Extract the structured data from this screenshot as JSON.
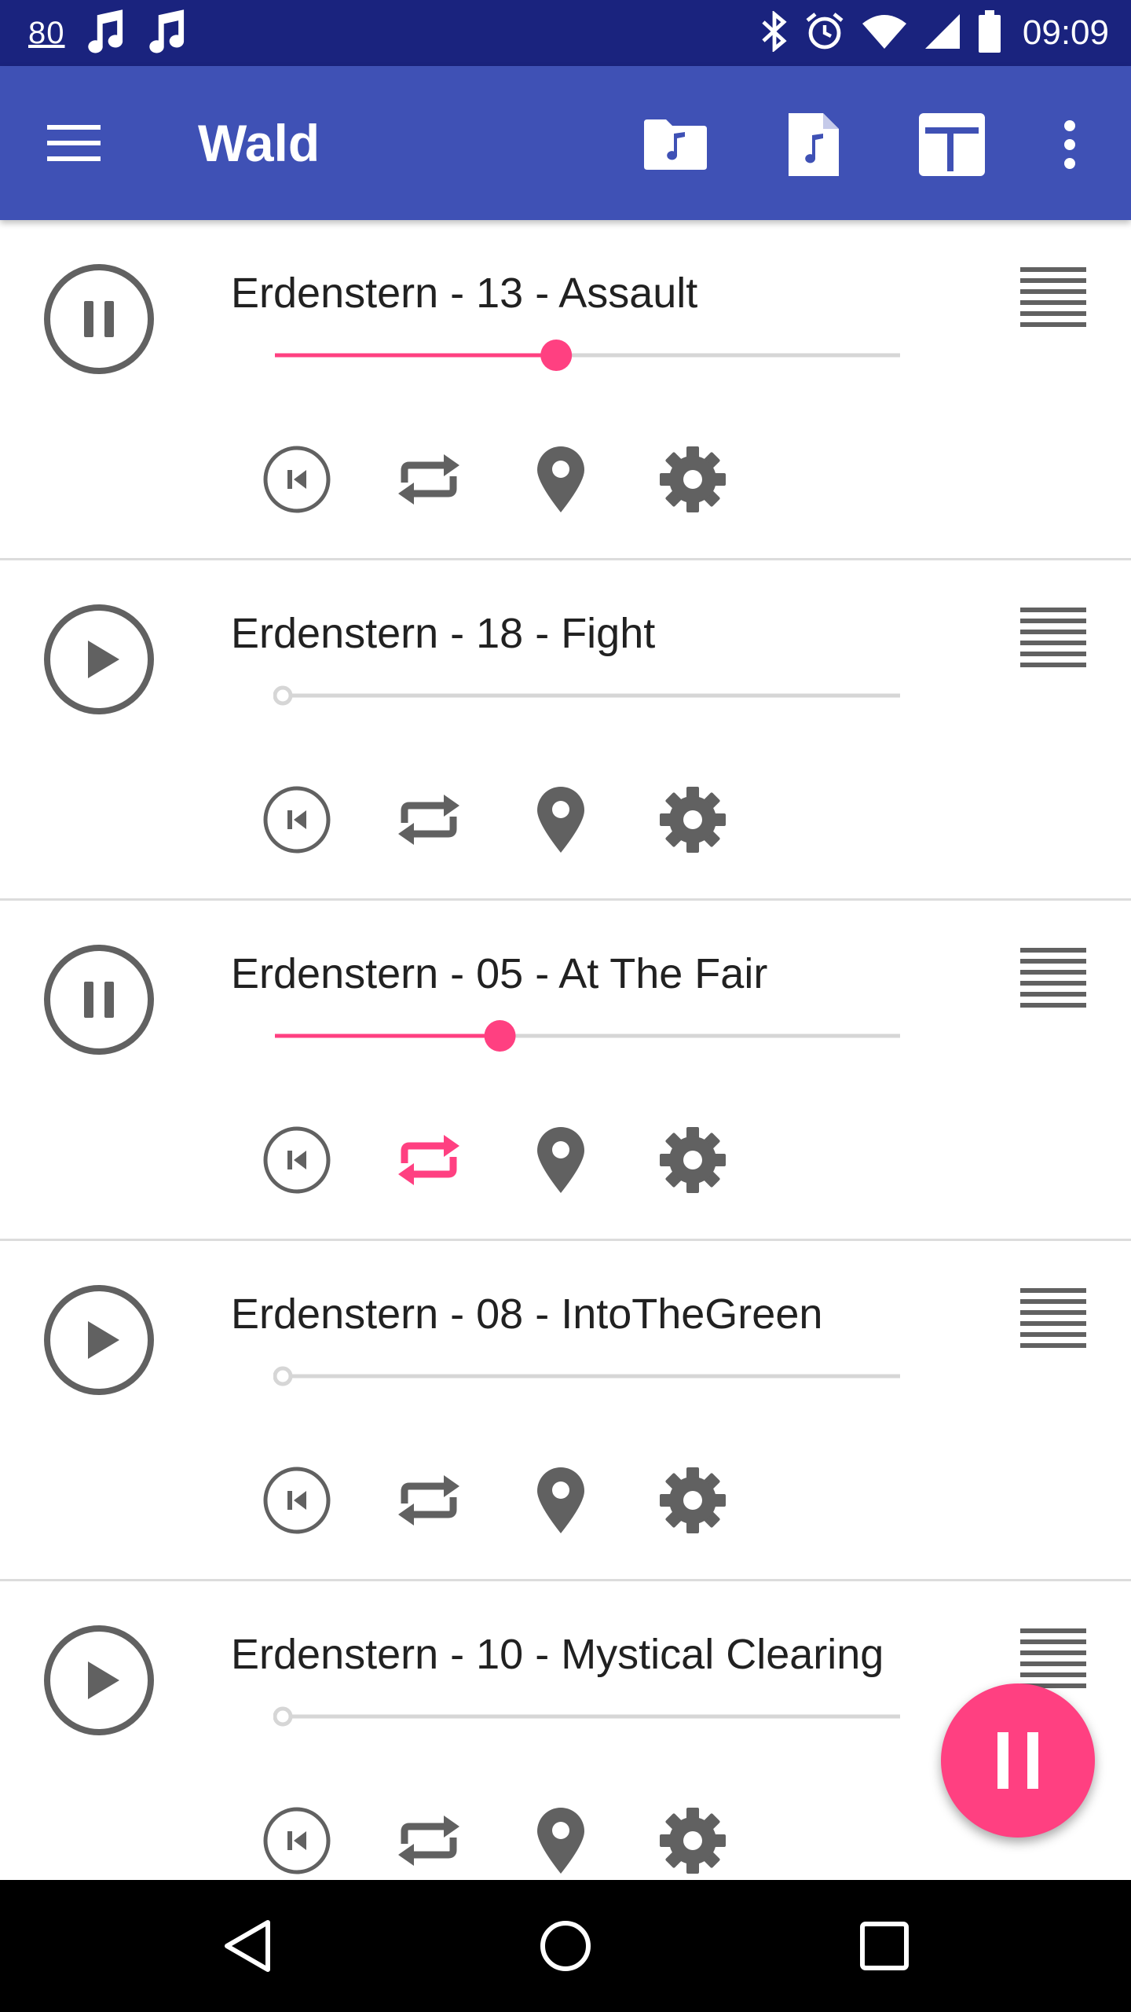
{
  "status_bar": {
    "left_number": "80",
    "time": "09:09",
    "icons": [
      "music-note-icon",
      "music-note-icon",
      "bluetooth-icon",
      "alarm-icon",
      "wifi-icon",
      "signal-icon",
      "battery-icon"
    ]
  },
  "toolbar": {
    "title": "Wald",
    "actions": [
      "add-folder-music-icon",
      "add-file-music-icon",
      "grid-layout-icon",
      "more-vert-icon"
    ]
  },
  "colors": {
    "status_bar": "#1a237e",
    "toolbar": "#3f51b5",
    "accent": "#ff4081",
    "icon_gray": "#616161",
    "track_gray": "#d6d6d6"
  },
  "tracks": [
    {
      "title": "Erdenstern - 13 - Assault",
      "playing": true,
      "progress": 0.45,
      "repeat_active": false
    },
    {
      "title": "Erdenstern - 18 - Fight",
      "playing": false,
      "progress": 0,
      "repeat_active": false
    },
    {
      "title": "Erdenstern - 05 - At The Fair",
      "playing": true,
      "progress": 0.36,
      "repeat_active": true
    },
    {
      "title": "Erdenstern - 08 - IntoTheGreen",
      "playing": false,
      "progress": 0,
      "repeat_active": false
    },
    {
      "title": "Erdenstern - 10 - Mystical Clearing",
      "playing": false,
      "progress": 0,
      "repeat_active": false
    }
  ],
  "fab": {
    "icon": "pause-all-icon"
  },
  "nav_bar": {
    "icons": [
      "back-icon",
      "home-icon",
      "recents-icon"
    ]
  }
}
